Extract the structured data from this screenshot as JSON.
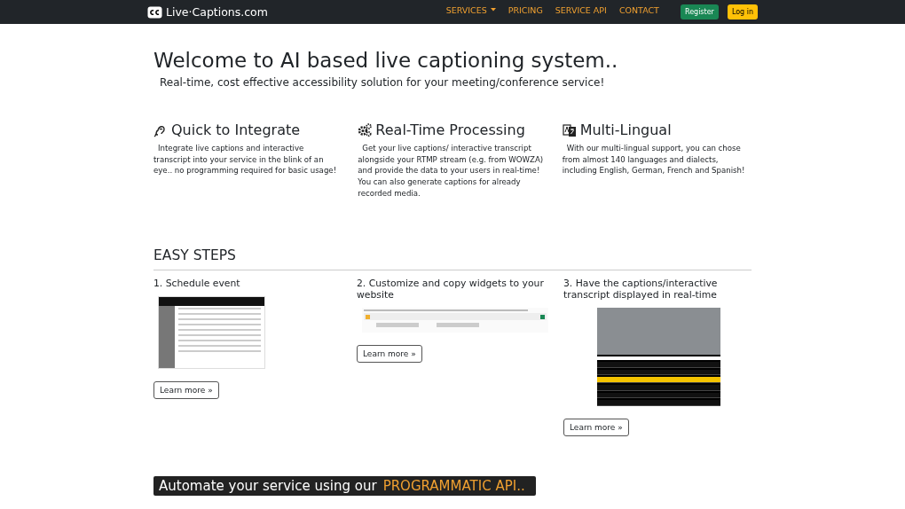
{
  "navbar": {
    "brand": "Live·Captions.com",
    "links": [
      {
        "label": "SERVICES",
        "dropdown": true
      },
      {
        "label": "PRICING",
        "dropdown": false
      },
      {
        "label": "SERVICE API",
        "dropdown": false
      },
      {
        "label": "CONTACT",
        "dropdown": false
      }
    ],
    "buttons": [
      {
        "label": "Register",
        "kind": "success"
      },
      {
        "label": "Log in",
        "kind": "warning"
      }
    ]
  },
  "hero": {
    "title": "Welcome to AI based live captioning system..",
    "subtitle": "Real-time, cost effective accessibility solution for your meeting/conference service!"
  },
  "features": [
    {
      "title": "Quick to Integrate",
      "text": "Integrate live captions and interactive transcript into your service in the blink of an eye.. no programming required for basic usage!"
    },
    {
      "title": "Real-Time Processing",
      "text": "Get your live captions/ interactive transcript alongside your RTMP stream (e.g. from WOWZA) and provide the data to your users in real-time! You can also generate captions for already recorded media."
    },
    {
      "title": "Multi-Lingual",
      "text": "With our multi-lingual support, you can chose from almost 140 languages and dialects, including English, German, French and Spanish!"
    }
  ],
  "steps_heading": "EASY STEPS",
  "steps": [
    {
      "title": "1. Schedule event",
      "button": "Learn more »"
    },
    {
      "title": "2. Customize and copy widgets to your website",
      "button": "Learn more »"
    },
    {
      "title": "3. Have the captions/interactive transcript displayed in real-time",
      "button": "Learn more »"
    }
  ],
  "api_banner": {
    "text": "Automate your service using our",
    "highlight": "PROGRAMMATIC API.."
  }
}
